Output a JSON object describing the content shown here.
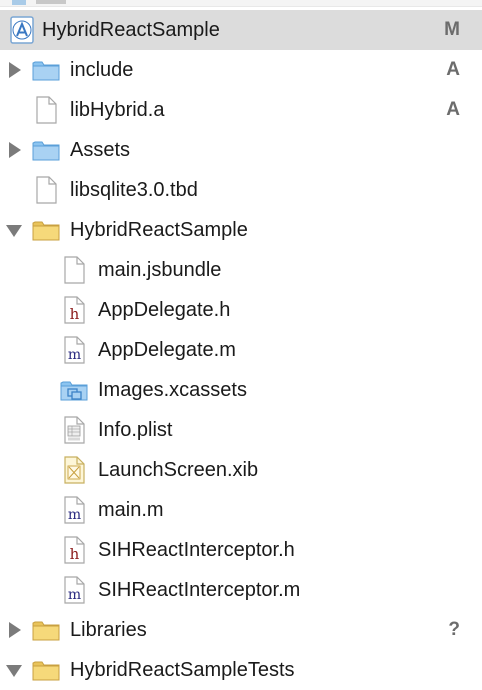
{
  "navigator": {
    "project": {
      "label": "HybridReactSample",
      "status": "M"
    },
    "items": [
      {
        "label": "include",
        "status": "A"
      },
      {
        "label": "libHybrid.a",
        "status": "A"
      },
      {
        "label": "Assets",
        "status": ""
      },
      {
        "label": "libsqlite3.0.tbd",
        "status": ""
      },
      {
        "label": "HybridReactSample",
        "status": ""
      },
      {
        "label": "main.jsbundle",
        "status": ""
      },
      {
        "label": "AppDelegate.h",
        "status": ""
      },
      {
        "label": "AppDelegate.m",
        "status": ""
      },
      {
        "label": "Images.xcassets",
        "status": ""
      },
      {
        "label": "Info.plist",
        "status": ""
      },
      {
        "label": "LaunchScreen.xib",
        "status": ""
      },
      {
        "label": "main.m",
        "status": ""
      },
      {
        "label": "SIHReactInterceptor.h",
        "status": ""
      },
      {
        "label": "SIHReactInterceptor.m",
        "status": ""
      },
      {
        "label": "Libraries",
        "status": "?"
      },
      {
        "label": "HybridReactSampleTests",
        "status": ""
      }
    ]
  },
  "colors": {
    "selection": "#dcdcdc",
    "blue_folder": "#8cc4f0",
    "yellow_folder": "#f3d36e",
    "status_text": "#6c6c6c",
    "header_source_letter": "#8b1a1a",
    "implementation_letter": "#2a2a80"
  }
}
